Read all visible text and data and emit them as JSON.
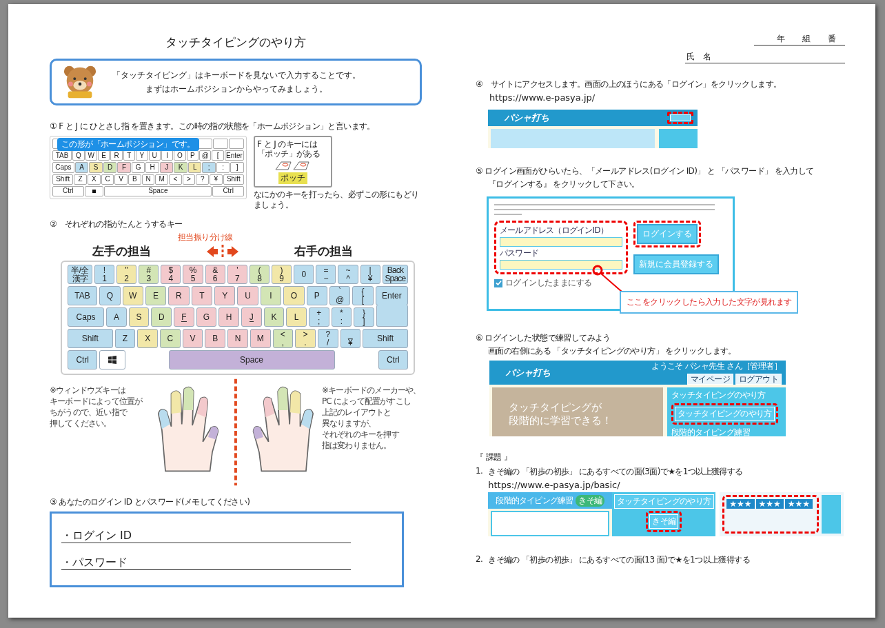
{
  "title": "タッチタイピングのやり方",
  "class_line": [
    "年",
    "組",
    "番"
  ],
  "name_label": "氏　名",
  "intro": [
    "「タッチタイピング」はキーボードを見ないで入力することです。",
    "まずはホームポジションからやってみましょう。"
  ],
  "step1": {
    "heading": "①  F と J に  ひとさし指  を置きます。この時の指の状態を「ホームポジション」と言います。",
    "bubble": "この形が「ホームポジション」です。",
    "mini_keyboard": [
      [
        {
          "label": "TAB",
          "kind": "wide"
        },
        {
          "label": "Q",
          "kind": "key"
        },
        {
          "label": "W",
          "kind": "key"
        },
        {
          "label": "E",
          "kind": "key"
        },
        {
          "label": "R",
          "kind": "key"
        },
        {
          "label": "T",
          "kind": "key"
        },
        {
          "label": "Y",
          "kind": "key"
        },
        {
          "label": "U",
          "kind": "key"
        },
        {
          "label": "I",
          "kind": "key"
        },
        {
          "label": "O",
          "kind": "key"
        },
        {
          "label": "P",
          "kind": "key"
        },
        {
          "label": "@",
          "kind": "key"
        },
        {
          "label": "[",
          "kind": "key"
        },
        {
          "label": "Enter",
          "kind": "wide"
        }
      ],
      [
        {
          "label": "Caps",
          "kind": "wide"
        },
        {
          "label": "A",
          "kind": "key",
          "color": "#b9dcee"
        },
        {
          "label": "S",
          "kind": "key",
          "color": "#f2e7a8"
        },
        {
          "label": "D",
          "kind": "key",
          "color": "#d3e5b5"
        },
        {
          "label": "F",
          "kind": "key",
          "color": "#f3c9cc"
        },
        {
          "label": "G",
          "kind": "key"
        },
        {
          "label": "H",
          "kind": "key"
        },
        {
          "label": "J",
          "kind": "key",
          "color": "#f3c9cc"
        },
        {
          "label": "K",
          "kind": "key",
          "color": "#d3e5b5"
        },
        {
          "label": "L",
          "kind": "key",
          "color": "#f2e7a8"
        },
        {
          "label": ";",
          "kind": "key",
          "color": "#b9dcee"
        },
        {
          "label": ":",
          "kind": "key"
        },
        {
          "label": "]",
          "kind": "key"
        }
      ],
      [
        {
          "label": "Shift",
          "kind": "wide"
        },
        {
          "label": "Z",
          "kind": "key"
        },
        {
          "label": "X",
          "kind": "key"
        },
        {
          "label": "C",
          "kind": "key"
        },
        {
          "label": "V",
          "kind": "key"
        },
        {
          "label": "B",
          "kind": "key"
        },
        {
          "label": "N",
          "kind": "key"
        },
        {
          "label": "M",
          "kind": "key"
        },
        {
          "label": "<",
          "kind": "key"
        },
        {
          "label": ">",
          "kind": "key"
        },
        {
          "label": "?",
          "kind": "key"
        },
        {
          "label": "¥",
          "kind": "key"
        },
        {
          "label": "Shift",
          "kind": "wide"
        }
      ],
      [
        {
          "label": "Ctrl",
          "kind": "wide"
        },
        {
          "kind": "win"
        },
        {
          "label": "Space",
          "kind": "space"
        },
        {
          "label": "Ctrl",
          "kind": "wide"
        }
      ]
    ],
    "bump_note": [
      "F と J のキーには",
      "「ポッチ」がある"
    ],
    "bump_tag": "ポッチ",
    "caption": "なにかのキーを打ったら、必ずこの形にもどりましょう。"
  },
  "step2": {
    "heading": "②　それぞれの指がたんとうするキー",
    "divider_label": "担当振り分け線",
    "left_label": "左手の担当",
    "right_label": "右手の担当",
    "keyboard": [
      [
        {
          "label": "半/全",
          "sub": "漢字",
          "kind": "zen",
          "color": "#b9dcee"
        },
        {
          "label": "!",
          "sub": "1",
          "kind": "char",
          "color": "#b9dcee"
        },
        {
          "label": "\"",
          "sub": "2",
          "kind": "char",
          "color": "#f2e7a8"
        },
        {
          "label": "#",
          "sub": "3",
          "kind": "char",
          "color": "#d3e5b5"
        },
        {
          "label": "$",
          "sub": "4",
          "kind": "char",
          "color": "#f3c9cc"
        },
        {
          "label": "%",
          "sub": "5",
          "kind": "char",
          "color": "#f3c9cc"
        },
        {
          "label": "&",
          "sub": "6",
          "kind": "char",
          "color": "#f3c9cc"
        },
        {
          "label": "'",
          "sub": "7",
          "kind": "char",
          "color": "#f3c9cc"
        },
        {
          "label": "(",
          "sub": "8",
          "kind": "char",
          "color": "#d3e5b5"
        },
        {
          "label": ")",
          "sub": "9",
          "kind": "char",
          "color": "#f2e7a8"
        },
        {
          "label": "0",
          "kind": "char",
          "color": "#b9dcee"
        },
        {
          "label": "=",
          "sub": "−",
          "kind": "char",
          "color": "#b9dcee"
        },
        {
          "label": "~",
          "sub": "^",
          "kind": "char",
          "color": "#b9dcee"
        },
        {
          "label": "|",
          "sub": "¥",
          "kind": "char",
          "color": "#b9dcee"
        },
        {
          "label": "Back",
          "sub": "Space",
          "kind": "back",
          "color": "#b9dcee"
        }
      ],
      [
        {
          "label": "TAB",
          "kind": "tab",
          "color": "#b9dcee"
        },
        {
          "label": "Q",
          "kind": "char",
          "color": "#b9dcee"
        },
        {
          "label": "W",
          "kind": "char",
          "color": "#f2e7a8"
        },
        {
          "label": "E",
          "kind": "char",
          "color": "#d3e5b5"
        },
        {
          "label": "R",
          "kind": "char",
          "color": "#f3c9cc"
        },
        {
          "label": "T",
          "kind": "char",
          "color": "#f3c9cc"
        },
        {
          "label": "Y",
          "kind": "char",
          "color": "#f3c9cc"
        },
        {
          "label": "U",
          "kind": "char",
          "color": "#f3c9cc"
        },
        {
          "label": "I",
          "kind": "char",
          "color": "#d3e5b5"
        },
        {
          "label": "O",
          "kind": "char",
          "color": "#f2e7a8"
        },
        {
          "label": "P",
          "kind": "char",
          "color": "#b9dcee"
        },
        {
          "label": "`",
          "sub": "@",
          "kind": "char",
          "color": "#b9dcee"
        },
        {
          "label": "{",
          "sub": "[",
          "kind": "char",
          "color": "#b9dcee"
        },
        {
          "label": "Enter",
          "kind": "enter",
          "color": "#b9dcee"
        }
      ],
      [
        {
          "label": "Caps",
          "kind": "caps",
          "color": "#b9dcee"
        },
        {
          "label": "A",
          "kind": "char",
          "color": "#b9dcee"
        },
        {
          "label": "S",
          "kind": "char",
          "color": "#f2e7a8"
        },
        {
          "label": "D",
          "kind": "char",
          "color": "#d3e5b5"
        },
        {
          "label": "F",
          "kind": "home",
          "color": "#f3c9cc"
        },
        {
          "label": "G",
          "kind": "char",
          "color": "#f3c9cc"
        },
        {
          "label": "H",
          "kind": "char",
          "color": "#f3c9cc"
        },
        {
          "label": "J",
          "kind": "home",
          "color": "#f3c9cc"
        },
        {
          "label": "K",
          "kind": "char",
          "color": "#d3e5b5"
        },
        {
          "label": "L",
          "kind": "char",
          "color": "#f2e7a8"
        },
        {
          "label": "+",
          "sub": ";",
          "kind": "char",
          "color": "#b9dcee"
        },
        {
          "label": "*",
          "sub": ":",
          "kind": "char",
          "color": "#b9dcee"
        },
        {
          "label": "}",
          "sub": "]",
          "kind": "char",
          "color": "#b9dcee"
        },
        {
          "kind": "enter_tail",
          "color": "#b9dcee"
        }
      ],
      [
        {
          "label": "Shift",
          "kind": "shift",
          "color": "#b9dcee"
        },
        {
          "label": "Z",
          "kind": "char",
          "color": "#b9dcee"
        },
        {
          "label": "X",
          "kind": "char",
          "color": "#f2e7a8"
        },
        {
          "label": "C",
          "kind": "char",
          "color": "#d3e5b5"
        },
        {
          "label": "V",
          "kind": "char",
          "color": "#f3c9cc"
        },
        {
          "label": "B",
          "kind": "char",
          "color": "#f3c9cc"
        },
        {
          "label": "N",
          "kind": "char",
          "color": "#f3c9cc"
        },
        {
          "label": "M",
          "kind": "char",
          "color": "#f3c9cc"
        },
        {
          "label": "<",
          "sub": ",",
          "kind": "char",
          "color": "#d3e5b5"
        },
        {
          "label": ">",
          "sub": ".",
          "kind": "char",
          "color": "#f2e7a8"
        },
        {
          "label": "?",
          "sub": "/",
          "kind": "char",
          "color": "#b9dcee"
        },
        {
          "label": "_",
          "sub": "¥",
          "kind": "char",
          "color": "#b9dcee"
        },
        {
          "label": "Shift",
          "kind": "shift",
          "color": "#b9dcee"
        }
      ],
      [
        {
          "label": "Ctrl",
          "kind": "ctrl",
          "color": "#b9dcee"
        },
        {
          "kind": "win",
          "color": "#ffffff"
        },
        {
          "label": "Space",
          "kind": "space",
          "color": "#c3b1d8"
        },
        {
          "label": "Ctrl",
          "kind": "ctrl",
          "color": "#b9dcee"
        }
      ]
    ],
    "left_note": [
      "※ウィンドウズキーは",
      "キーボードによって位置が",
      "ちがうので、近い指で",
      "押してください。"
    ],
    "right_note": [
      "※キーボードのメーカーや、",
      "PC によって配置がすこし",
      "上記のレイアウトと",
      "異なりますが、",
      "それぞれのキーを押す",
      "指は変わりません。"
    ]
  },
  "step3": {
    "heading": "③  あなたのログイン ID とパスワード(メモしてください)",
    "fields": [
      "・ログイン ID",
      "・パスワード"
    ]
  },
  "step4": {
    "heading": "④　サイトにアクセスします。画面の上のほうにある「ログイン」をクリックします。",
    "url": "https://www.e-pasya.jp/",
    "logo": "パシャ打ち"
  },
  "step5": {
    "heading": [
      "⑤  ログイン画面がひらいたら、「メールアドレス(ログイン ID)」 と 「パスワード」 を入力して",
      "『ログインする』 をクリックして下さい。"
    ],
    "email_label": "メールアドレス（ログインID）",
    "password_label": "パスワード",
    "remember": {
      "label": "ログインしたままにする",
      "checked": true
    },
    "login_button": "ログインする",
    "register_button": "新規に会員登録する",
    "callout": "ここをクリックしたら入力した文字が見れます"
  },
  "step6": {
    "heading": [
      "⑥  ログインした状態で練習してみよう",
      "画面の右側にある 「タッチタイピングのやり方」 をクリックします。"
    ],
    "logo": "パシャ打ち",
    "welcome": "ようこそ パシャ先生 さん［管理者］",
    "buttons": [
      "マイページ",
      "ログアウト"
    ],
    "hero": [
      "タッチタイピングが",
      "段階的に学習できる！"
    ],
    "menu": [
      "タッチタイピングのやり方",
      "タッチタイピングのやり方",
      "段階的タイピング練習"
    ]
  },
  "task": {
    "heading": "『  課題  』",
    "items": [
      {
        "number": "1.",
        "text": "きそ編の 「初歩の初歩」 にあるすべての面(3面)で★を1つ以上獲得する",
        "url": "https://www.e-pasya.jp/basic/"
      },
      {
        "number": "2.",
        "text": "きそ編の 「初歩の初歩」 にあるすべての面(13 面)で★を1つ以上獲得する"
      }
    ],
    "banner": "段階的タイピング練習",
    "banner_tag": "きそ編",
    "side_button": "タッチタイピングのやり方",
    "course": "きそ編",
    "stages": [
      "★★★",
      "★★★",
      "★★★"
    ]
  }
}
